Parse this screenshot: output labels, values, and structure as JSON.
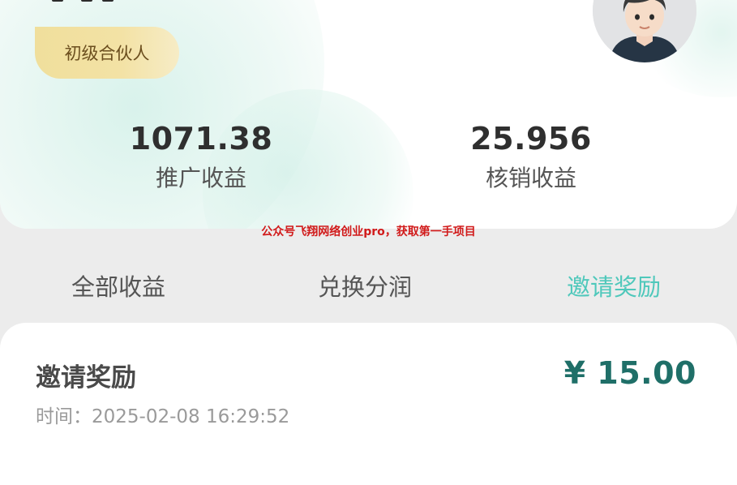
{
  "profile": {
    "level_badge": "初级合伙人",
    "avatar_icon": "person-avatar-icon"
  },
  "stats": [
    {
      "value": "1071.38",
      "label": "推广收益"
    },
    {
      "value": "25.956",
      "label": "核销收益"
    }
  ],
  "watermark": "公众号飞翔网络创业pro，获取第一手项目",
  "tabs": [
    {
      "label": "全部收益",
      "active": false
    },
    {
      "label": "兑换分润",
      "active": false
    },
    {
      "label": "邀请奖励",
      "active": true
    }
  ],
  "record": {
    "title": "邀请奖励",
    "amount": "¥ 15.00",
    "time_label": "时间：",
    "time": "2025-02-08 16:29:52"
  },
  "colors": {
    "accent": "#4fc8bb",
    "amount": "#1f6f68",
    "badge": "#f0df9c"
  }
}
